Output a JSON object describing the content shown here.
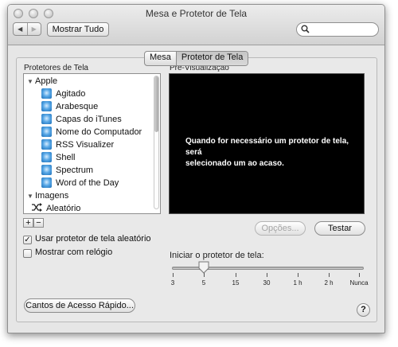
{
  "window": {
    "title": "Mesa e Protetor de Tela"
  },
  "toolbar": {
    "back_icon": "◀",
    "forward_icon": "▶",
    "show_all": "Mostrar Tudo",
    "search_placeholder": ""
  },
  "tabs": [
    {
      "label": "Mesa",
      "selected": false
    },
    {
      "label": "Protetor de Tela",
      "selected": true
    }
  ],
  "screensavers": {
    "label": "Protetores de Tela",
    "groups": [
      {
        "name": "Apple",
        "expanded": true,
        "items": [
          "Agitado",
          "Arabesque",
          "Capas do iTunes",
          "Nome do Computador",
          "RSS Visualizer",
          "Shell",
          "Spectrum",
          "Word of the Day"
        ]
      },
      {
        "name": "Imagens",
        "expanded": true,
        "items": []
      }
    ],
    "random_item": "Aleatório",
    "add_label": "+",
    "remove_label": "−",
    "scroll_position": 0.0
  },
  "preview": {
    "label": "Pré-Visualização",
    "message_line1": "Quando for necessário um protetor de tela, será",
    "message_line2": "selecionado um ao acaso."
  },
  "buttons": {
    "options": "Opções...",
    "test": "Testar",
    "hot_corners": "Cantos de Acesso Rápido...",
    "help": "?"
  },
  "checkboxes": [
    {
      "label": "Usar protetor de tela aleatório",
      "checked": true
    },
    {
      "label": "Mostrar com relógio",
      "checked": false
    }
  ],
  "slider": {
    "label": "Iniciar o protetor de tela:",
    "ticks": [
      "3",
      "5",
      "15",
      "30",
      "1 h",
      "2 h",
      "Nunca"
    ],
    "selected_index": 1
  },
  "colors": {
    "preview_bg": "#000000",
    "window_bg": "#e6e6e6",
    "accent_icon": "#3b8fd6"
  }
}
